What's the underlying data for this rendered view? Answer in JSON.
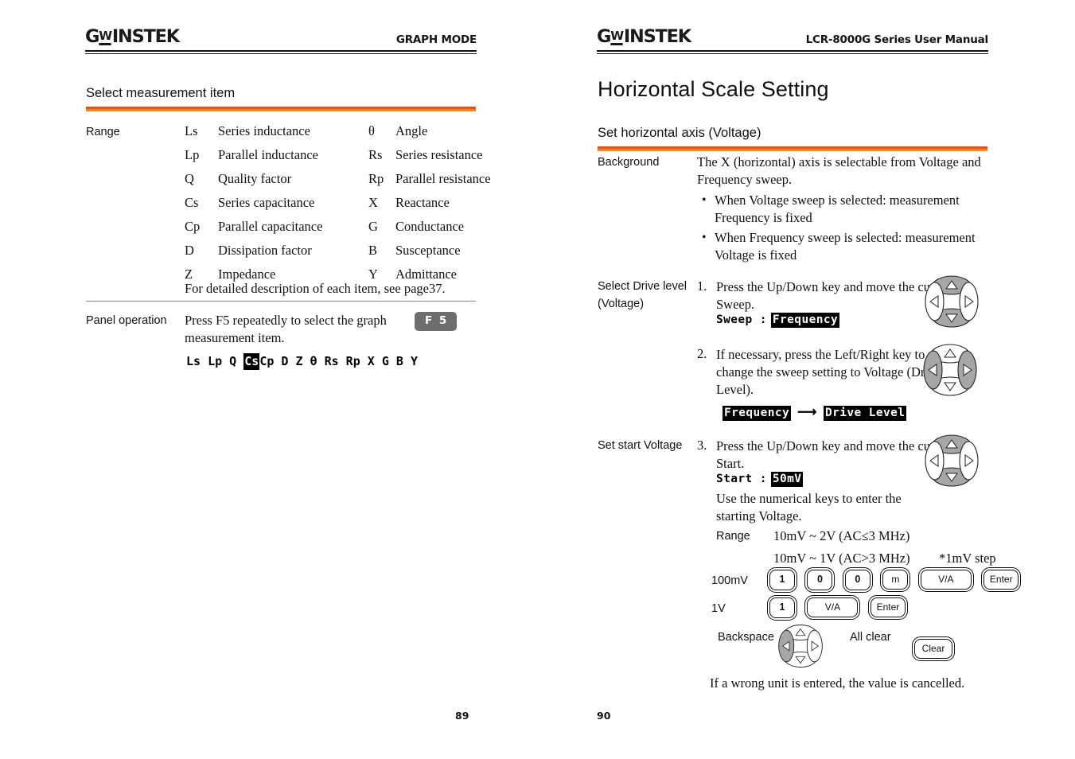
{
  "brand": {
    "logo_text": "G INSTEK",
    "logo_w": "W"
  },
  "left_page": {
    "header_title": "GRAPH MODE",
    "page_number": "89",
    "section_title": "Select measurement item",
    "range_label": "Range",
    "measurement_items": [
      {
        "sym1": "Ls",
        "name1": "Series inductance",
        "sym2": "θ",
        "name2": "Angle"
      },
      {
        "sym1": "Lp",
        "name1": "Parallel inductance",
        "sym2": "Rs",
        "name2": "Series resistance"
      },
      {
        "sym1": "Q",
        "name1": "Quality factor",
        "sym2": "Rp",
        "name2": "Parallel resistance"
      },
      {
        "sym1": "Cs",
        "name1": "Series capacitance",
        "sym2": "X",
        "name2": "Reactance"
      },
      {
        "sym1": "Cp",
        "name1": "Parallel capacitance",
        "sym2": "G",
        "name2": "Conductance"
      },
      {
        "sym1": "D",
        "name1": "Dissipation factor",
        "sym2": "B",
        "name2": "Susceptance"
      },
      {
        "sym1": "Z",
        "name1": "Impedance",
        "sym2": "Y",
        "name2": "Admittance"
      }
    ],
    "detail_note": "For detailed description of each item, see page37.",
    "panel_operation_label": "Panel operation",
    "panel_operation_text": "Press F5 repeatedly to select the graph measurement item.",
    "f5_key_label": "F 5",
    "symbol_row": {
      "before": "Ls Lp Q ",
      "highlighted": "Cs",
      "after": "Cp D Z θ Rs Rp X G B Y"
    }
  },
  "right_page": {
    "header_title": "LCR-8000G Series User Manual",
    "page_number": "90",
    "title": "Horizontal Scale Setting",
    "section_title": "Set horizontal axis (Voltage)",
    "background": {
      "label": "Background",
      "text": "The X (horizontal) axis is selectable from Voltage and Frequency sweep.",
      "bullets": [
        "When Voltage sweep is selected: measurement Frequency is fixed",
        "When Frequency sweep is selected: measurement Voltage is fixed"
      ]
    },
    "drive_level": {
      "label_line1": "Select Drive level",
      "label_line2": "(Voltage)",
      "step1_num": "1.",
      "step1_text": "Press the Up/Down key and move the cursor to Sweep.",
      "step1_mono_prefix": "Sweep :",
      "step1_mono_value": "Frequency",
      "step2_num": "2.",
      "step2_text": "If necessary, press the Left/Right key to change the sweep setting to Voltage (Drive Level).",
      "step2_from": "Frequency",
      "step2_arrow": "⟶",
      "step2_to": "Drive Level"
    },
    "start_voltage": {
      "label": "Set start Voltage",
      "step3_num": "3.",
      "step3_text": "Press the Up/Down key and move the cursor to Start.",
      "mono_prefix": "Start :",
      "mono_value": "50mV",
      "hint": "Use the numerical keys to enter the starting Voltage.",
      "range_label": "Range",
      "range_line1": "10mV ~ 2V (AC≤3 MHz)",
      "range_line2": "10mV ~ 1V (AC>3 MHz)",
      "range_note": "*1mV step",
      "example1_label": "100mV",
      "example1_keys": [
        "1",
        "0",
        "0",
        "m",
        "V/A",
        "Enter"
      ],
      "example2_label": "1V",
      "example2_keys": [
        "1",
        "V/A",
        "Enter"
      ],
      "backspace_label": "Backspace",
      "allclear_label": "All clear",
      "clear_key_label": "Clear",
      "footer_note": "If a wrong unit is entered, the value is cancelled."
    }
  },
  "colors": {
    "accent_dark": "#e8511a",
    "accent_light": "#f7851e",
    "key_gray": "#6e6e6e",
    "rule_gray": "#8a8a8a"
  }
}
